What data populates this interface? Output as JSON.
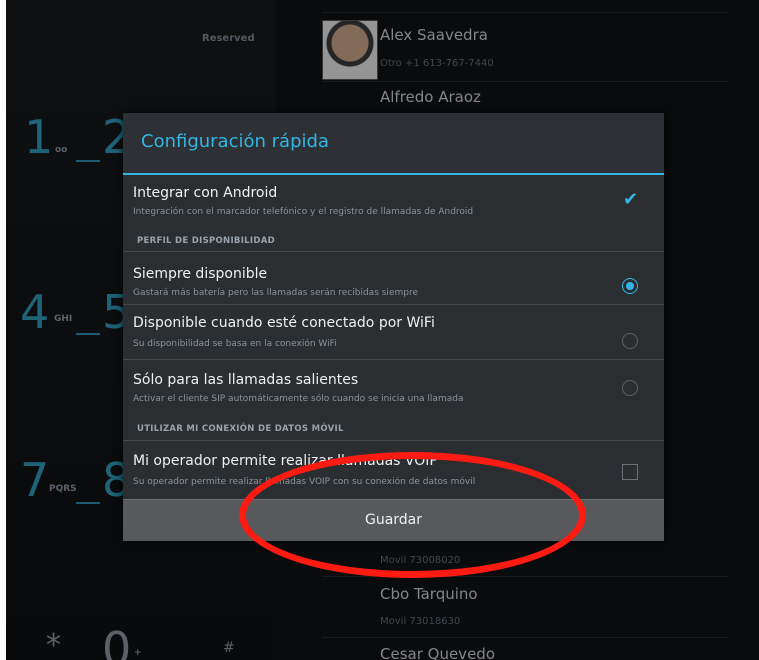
{
  "dialer": {
    "reserved": "Reserved",
    "keys": [
      {
        "digit": "1",
        "sub": "oo"
      },
      {
        "digit": "2",
        "sub": ""
      },
      {
        "digit": "4",
        "sub": "GHI"
      },
      {
        "digit": "5",
        "sub": ""
      },
      {
        "digit": "7",
        "sub": "PQRS"
      },
      {
        "digit": "8",
        "sub": ""
      },
      {
        "digit": "*",
        "sub": ""
      },
      {
        "digit": "0",
        "sub": "+"
      },
      {
        "digit": "#",
        "sub": ""
      }
    ]
  },
  "contacts": [
    {
      "name": "Alex Saavedra",
      "sub": "Otro +1 613-767-7440"
    },
    {
      "name": "Alfredo Araoz",
      "sub": ""
    },
    {
      "name": "",
      "sub": "Movil 73008020"
    },
    {
      "name": "Cbo Tarquino",
      "sub": "Movil 73018630"
    },
    {
      "name": "Cesar Quevedo",
      "sub": ""
    }
  ],
  "dialog": {
    "title": "Configuración rápida",
    "rows": [
      {
        "title": "Integrar con Android",
        "desc": "Integración con el marcador telefónico y el registro de llamadas de Android",
        "control": "checkbox",
        "checked": true
      },
      {
        "title": "Siempre disponible",
        "desc": "Gastará más batería pero las llamadas serán recibidas siempre",
        "control": "radio",
        "checked": true
      },
      {
        "title": "Disponible cuando esté conectado por WiFi",
        "desc": "Su disponibilidad se basa en la conexión WiFi",
        "control": "radio",
        "checked": false
      },
      {
        "title": "Sólo para las llamadas salientes",
        "desc": "Activar el cliente SIP automáticamente sólo cuando se inicia una llamada",
        "control": "radio",
        "checked": false
      },
      {
        "title": "Mi operador permite realizar llamadas VOIP",
        "desc": "Su operador permite realizar llamadas VOIP con su conexión de datos móvil",
        "control": "checkbox",
        "checked": false
      }
    ],
    "sections": {
      "availability": "PERFIL DE DISPONIBILIDAD",
      "mobile_data": "UTILIZAR MI CONEXIÓN DE DATOS MÓVIL"
    },
    "save_label": "Guardar"
  },
  "colors": {
    "accent": "#33b5e5",
    "highlight": "#ff1a12"
  }
}
